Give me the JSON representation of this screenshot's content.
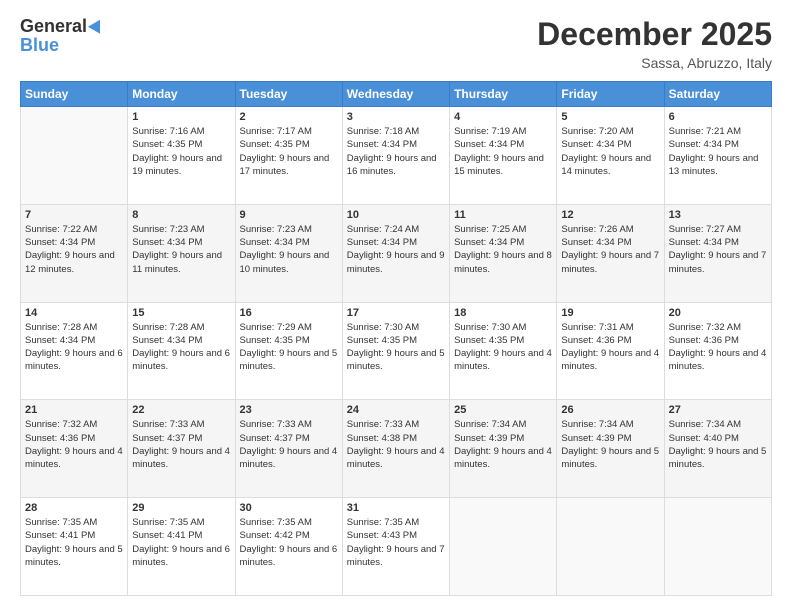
{
  "header": {
    "logo_line1": "General",
    "logo_line2": "Blue",
    "month": "December 2025",
    "location": "Sassa, Abruzzo, Italy"
  },
  "days_of_week": [
    "Sunday",
    "Monday",
    "Tuesday",
    "Wednesday",
    "Thursday",
    "Friday",
    "Saturday"
  ],
  "weeks": [
    [
      {
        "day": "",
        "sunrise": "",
        "sunset": "",
        "daylight": ""
      },
      {
        "day": "1",
        "sunrise": "7:16 AM",
        "sunset": "4:35 PM",
        "daylight": "9 hours and 19 minutes."
      },
      {
        "day": "2",
        "sunrise": "7:17 AM",
        "sunset": "4:35 PM",
        "daylight": "9 hours and 17 minutes."
      },
      {
        "day": "3",
        "sunrise": "7:18 AM",
        "sunset": "4:34 PM",
        "daylight": "9 hours and 16 minutes."
      },
      {
        "day": "4",
        "sunrise": "7:19 AM",
        "sunset": "4:34 PM",
        "daylight": "9 hours and 15 minutes."
      },
      {
        "day": "5",
        "sunrise": "7:20 AM",
        "sunset": "4:34 PM",
        "daylight": "9 hours and 14 minutes."
      },
      {
        "day": "6",
        "sunrise": "7:21 AM",
        "sunset": "4:34 PM",
        "daylight": "9 hours and 13 minutes."
      }
    ],
    [
      {
        "day": "7",
        "sunrise": "7:22 AM",
        "sunset": "4:34 PM",
        "daylight": "9 hours and 12 minutes."
      },
      {
        "day": "8",
        "sunrise": "7:23 AM",
        "sunset": "4:34 PM",
        "daylight": "9 hours and 11 minutes."
      },
      {
        "day": "9",
        "sunrise": "7:23 AM",
        "sunset": "4:34 PM",
        "daylight": "9 hours and 10 minutes."
      },
      {
        "day": "10",
        "sunrise": "7:24 AM",
        "sunset": "4:34 PM",
        "daylight": "9 hours and 9 minutes."
      },
      {
        "day": "11",
        "sunrise": "7:25 AM",
        "sunset": "4:34 PM",
        "daylight": "9 hours and 8 minutes."
      },
      {
        "day": "12",
        "sunrise": "7:26 AM",
        "sunset": "4:34 PM",
        "daylight": "9 hours and 7 minutes."
      },
      {
        "day": "13",
        "sunrise": "7:27 AM",
        "sunset": "4:34 PM",
        "daylight": "9 hours and 7 minutes."
      }
    ],
    [
      {
        "day": "14",
        "sunrise": "7:28 AM",
        "sunset": "4:34 PM",
        "daylight": "9 hours and 6 minutes."
      },
      {
        "day": "15",
        "sunrise": "7:28 AM",
        "sunset": "4:34 PM",
        "daylight": "9 hours and 6 minutes."
      },
      {
        "day": "16",
        "sunrise": "7:29 AM",
        "sunset": "4:35 PM",
        "daylight": "9 hours and 5 minutes."
      },
      {
        "day": "17",
        "sunrise": "7:30 AM",
        "sunset": "4:35 PM",
        "daylight": "9 hours and 5 minutes."
      },
      {
        "day": "18",
        "sunrise": "7:30 AM",
        "sunset": "4:35 PM",
        "daylight": "9 hours and 4 minutes."
      },
      {
        "day": "19",
        "sunrise": "7:31 AM",
        "sunset": "4:36 PM",
        "daylight": "9 hours and 4 minutes."
      },
      {
        "day": "20",
        "sunrise": "7:32 AM",
        "sunset": "4:36 PM",
        "daylight": "9 hours and 4 minutes."
      }
    ],
    [
      {
        "day": "21",
        "sunrise": "7:32 AM",
        "sunset": "4:36 PM",
        "daylight": "9 hours and 4 minutes."
      },
      {
        "day": "22",
        "sunrise": "7:33 AM",
        "sunset": "4:37 PM",
        "daylight": "9 hours and 4 minutes."
      },
      {
        "day": "23",
        "sunrise": "7:33 AM",
        "sunset": "4:37 PM",
        "daylight": "9 hours and 4 minutes."
      },
      {
        "day": "24",
        "sunrise": "7:33 AM",
        "sunset": "4:38 PM",
        "daylight": "9 hours and 4 minutes."
      },
      {
        "day": "25",
        "sunrise": "7:34 AM",
        "sunset": "4:39 PM",
        "daylight": "9 hours and 4 minutes."
      },
      {
        "day": "26",
        "sunrise": "7:34 AM",
        "sunset": "4:39 PM",
        "daylight": "9 hours and 5 minutes."
      },
      {
        "day": "27",
        "sunrise": "7:34 AM",
        "sunset": "4:40 PM",
        "daylight": "9 hours and 5 minutes."
      }
    ],
    [
      {
        "day": "28",
        "sunrise": "7:35 AM",
        "sunset": "4:41 PM",
        "daylight": "9 hours and 5 minutes."
      },
      {
        "day": "29",
        "sunrise": "7:35 AM",
        "sunset": "4:41 PM",
        "daylight": "9 hours and 6 minutes."
      },
      {
        "day": "30",
        "sunrise": "7:35 AM",
        "sunset": "4:42 PM",
        "daylight": "9 hours and 6 minutes."
      },
      {
        "day": "31",
        "sunrise": "7:35 AM",
        "sunset": "4:43 PM",
        "daylight": "9 hours and 7 minutes."
      },
      {
        "day": "",
        "sunrise": "",
        "sunset": "",
        "daylight": ""
      },
      {
        "day": "",
        "sunrise": "",
        "sunset": "",
        "daylight": ""
      },
      {
        "day": "",
        "sunrise": "",
        "sunset": "",
        "daylight": ""
      }
    ]
  ]
}
